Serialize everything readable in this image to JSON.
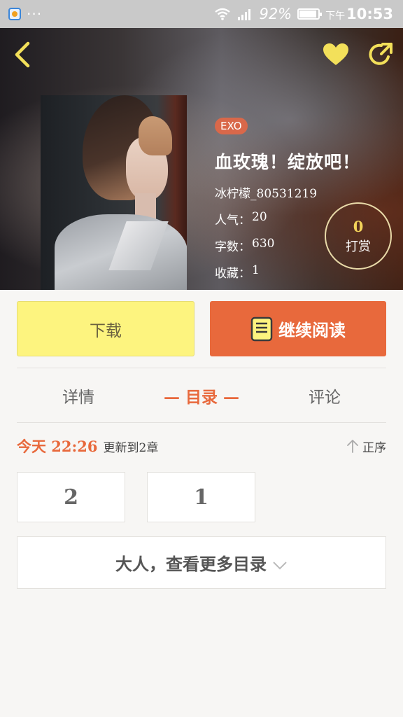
{
  "status_bar": {
    "dots": "···",
    "battery": "92%",
    "ampm": "下午",
    "time": "10:53"
  },
  "header": {
    "back_icon": "back-arrow-icon",
    "favorite_icon": "heart-icon",
    "share_icon": "share-icon",
    "accent_color": "#f3e05a"
  },
  "book": {
    "tag": "EXO",
    "title": "血玫瑰！绽放吧！",
    "author": "冰柠檬_80531219",
    "stats": [
      {
        "label": "人气：",
        "value": "20"
      },
      {
        "label": "字数：",
        "value": "630"
      },
      {
        "label": "收藏：",
        "value": "1"
      }
    ],
    "tip": {
      "count": "0",
      "label": "打赏"
    }
  },
  "actions": {
    "download_label": "下载",
    "read_label": "继续阅读",
    "download_color": "#fdf47f",
    "read_color": "#e8693c"
  },
  "tabs": [
    {
      "label": "详情",
      "active": false
    },
    {
      "label": "— 目录 —",
      "active": true
    },
    {
      "label": "评论",
      "active": false
    }
  ],
  "update": {
    "time": "今天 22:26",
    "text": "更新到2章",
    "sort_label": "正序"
  },
  "chapters": [
    "2",
    "1"
  ],
  "more_label": "大人，查看更多目录"
}
